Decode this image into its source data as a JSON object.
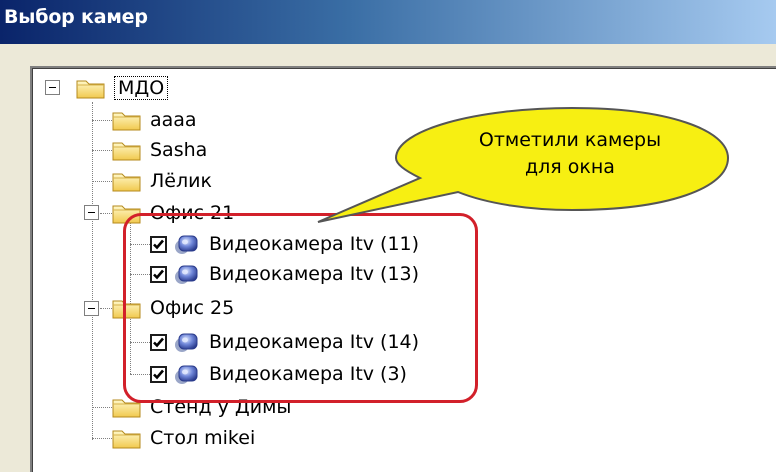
{
  "window": {
    "title": "Выбор камер"
  },
  "tree": {
    "root": {
      "label": "МДО"
    },
    "items": [
      {
        "label": "aaaa"
      },
      {
        "label": "Sasha"
      },
      {
        "label": "Лёлик"
      },
      {
        "label": "Офис 21"
      },
      {
        "label": "Видеокамера Itv (11)",
        "checked": true
      },
      {
        "label": "Видеокамера Itv (13)",
        "checked": true
      },
      {
        "label": "Офис 25"
      },
      {
        "label": "Видеокамера Itv (14)",
        "checked": true
      },
      {
        "label": "Видеокамера Itv (3)",
        "checked": true
      },
      {
        "label": "Стенд у Димы"
      },
      {
        "label": "Стол mikei"
      }
    ]
  },
  "annotation": {
    "line1": "Отметили камеры",
    "line2": "для окна",
    "bubble_color": "#f7ef12",
    "outline_color": "#d2202a"
  }
}
